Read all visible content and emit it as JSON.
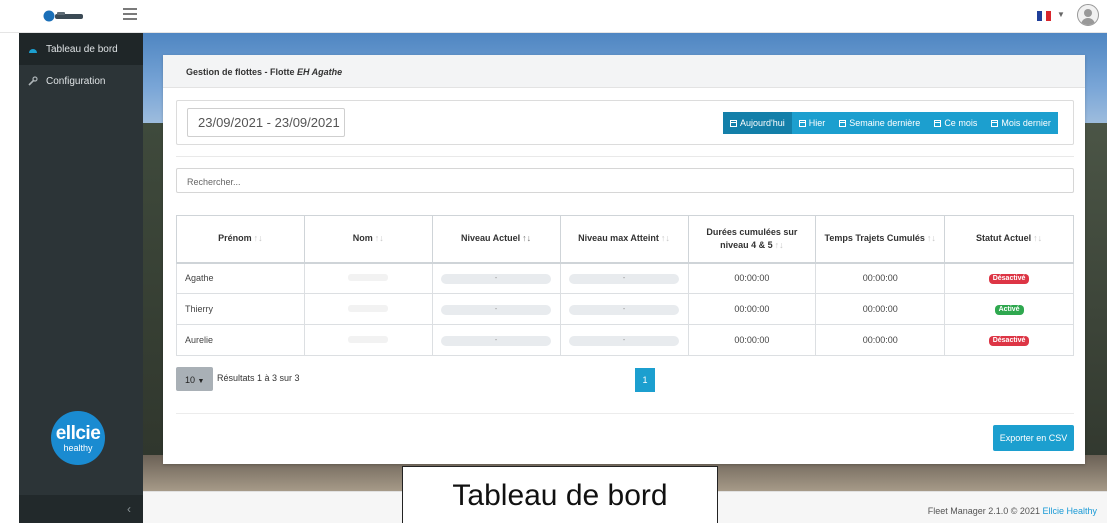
{
  "brand": {
    "footer_version": "Fleet Manager 2.1.0 © 2021",
    "footer_brand": "Ellcie Healthy",
    "side_logo_line1": "ellcie",
    "side_logo_line2": "healthy"
  },
  "sidebar": {
    "items": [
      {
        "label": "Tableau de bord",
        "icon": "dashboard-icon"
      },
      {
        "label": "Configuration",
        "icon": "wrench-icon"
      }
    ],
    "collapse_glyph": "‹"
  },
  "header": {
    "title_prefix": "Gestion de flottes - Flotte ",
    "fleet_name": "EH Agathe"
  },
  "filters": {
    "date_range": "23/09/2021 - 23/09/2021",
    "periods": [
      "Aujourd'hui",
      "Hier",
      "Semaine dernière",
      "Ce mois",
      "Mois dernier"
    ],
    "active_period": "Aujourd'hui",
    "search_placeholder": "Rechercher..."
  },
  "table": {
    "columns": [
      "Prénom",
      "Nom",
      "Niveau Actuel",
      "Niveau max Atteint",
      "Durées cumulées sur niveau 4 & 5",
      "Temps Trajets Cumulés",
      "Statut Actuel"
    ],
    "rows": [
      {
        "prenom": "Agathe",
        "niveau_actuel": "-",
        "niveau_max": "-",
        "durees": "00:00:00",
        "temps": "00:00:00",
        "statut": "Désactivé"
      },
      {
        "prenom": "Thierry",
        "niveau_actuel": "-",
        "niveau_max": "-",
        "durees": "00:00:00",
        "temps": "00:00:00",
        "statut": "Activé"
      },
      {
        "prenom": "Aurelie",
        "niveau_actuel": "-",
        "niveau_max": "-",
        "durees": "00:00:00",
        "temps": "00:00:00",
        "statut": "Désactivé"
      }
    ]
  },
  "pagination": {
    "page_size": "10",
    "results_text": "Résultats 1 à 3 sur 3",
    "current_page": "1"
  },
  "actions": {
    "export_label": "Exporter en CSV"
  },
  "caption": "Tableau de bord",
  "colors": {
    "accent": "#1c9fcf",
    "sidebar": "#2c3437",
    "status_off": "#dd3545",
    "status_on": "#2fa84f"
  }
}
